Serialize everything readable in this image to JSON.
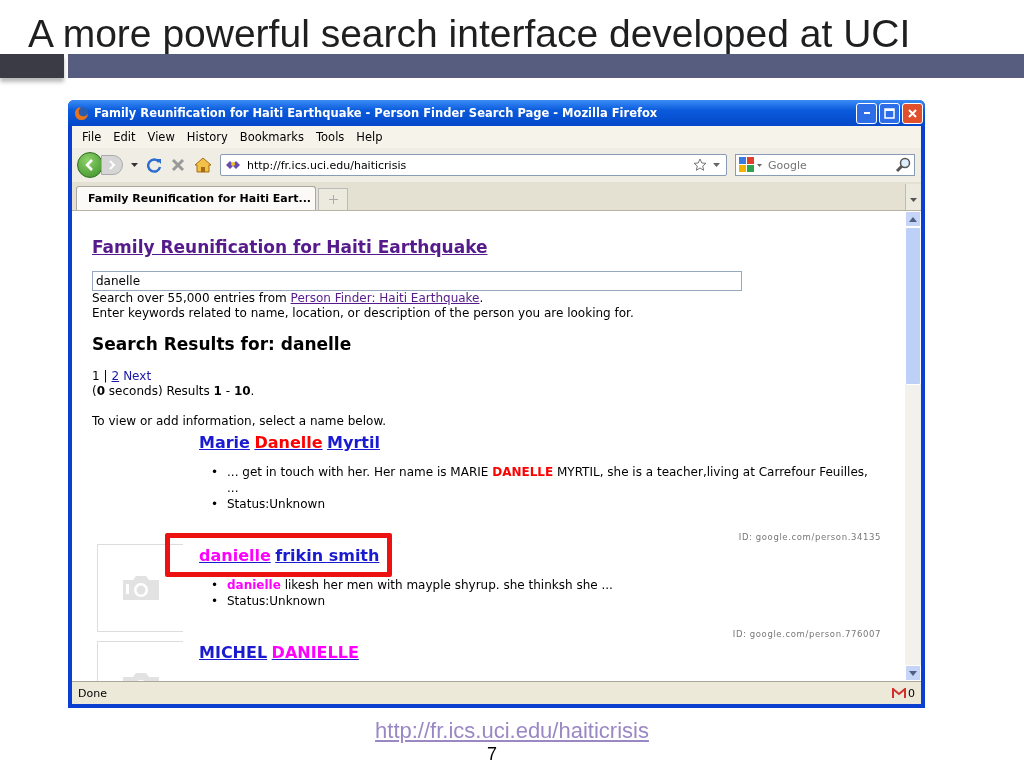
{
  "slide": {
    "title": "A more powerful search interface developed at UCI",
    "footer_link": "http://fr.ics.uci.edu/haiticrisis",
    "page_number": "7"
  },
  "browser": {
    "title": "Family Reunification for Haiti Earthquake - Person Finder Search Page - Mozilla Firefox",
    "menu": [
      "File",
      "Edit",
      "View",
      "History",
      "Bookmarks",
      "Tools",
      "Help"
    ],
    "address": "http://fr.ics.uci.edu/haiticrisis",
    "search_placeholder": "Google",
    "tabs": [
      {
        "label": "Family Reunification for Haiti Eart...",
        "selected": true
      }
    ],
    "status": "Done",
    "mail_count": "0"
  },
  "page": {
    "heading": "Family Reunification for Haiti Earthquake",
    "query": "danelle",
    "info": "Search over 55,000 entries from",
    "info_link": "Person Finder: Haiti Earthquake",
    "info_end": ".",
    "bullet": "•",
    "hint": "Enter keywords related to name, location, or description of the person you are looking for.",
    "results_heading": "Search Results for: danelle",
    "pager": [
      {
        "label": "1 |",
        "kind": "current"
      },
      {
        "label": "2",
        "kind": "page"
      },
      {
        "label": "Next",
        "kind": "next"
      }
    ],
    "stats": "(**0** seconds) Results **1** - **10**.",
    "instruction": "To view or add information, select a name below.",
    "results": [
      {
        "name": [
          {
            "text": "Marie",
            "match": false
          },
          {
            "text": "Danelle",
            "match": true
          },
          {
            "text": "Myrtil",
            "match": false
          }
        ],
        "color": "#ff0000",
        "snippet": [
          {
            "text": "... get in touch with her. Her name is MARIE ",
            "match": false
          },
          {
            "text": "DANELLE",
            "match": true
          },
          {
            "text": " MYRTIL, she is a teacher,living at Carrefour Feuilles, ...",
            "match": false
          }
        ],
        "status": "Status:Unknown",
        "id": "ID: google.com/person.34135",
        "photo": false,
        "outlined": false
      },
      {
        "name": [
          {
            "text": "danielle",
            "match": true
          },
          {
            "text": "frikin smith",
            "match": false
          }
        ],
        "color": "#ff00ff",
        "snippet": [
          {
            "text": "danielle",
            "match": true
          },
          {
            "text": " likesh her men with mayple shyrup. she thinksh she ...",
            "match": false
          }
        ],
        "status": "Status:Unknown",
        "id": "ID: google.com/person.776007",
        "photo": true,
        "outlined": true
      },
      {
        "name": [
          {
            "text": "MICHEL",
            "match": false
          },
          {
            "text": "DANIELLE",
            "match": true
          }
        ],
        "color": "#ff00ff",
        "photo": true,
        "outlined": false
      }
    ]
  }
}
